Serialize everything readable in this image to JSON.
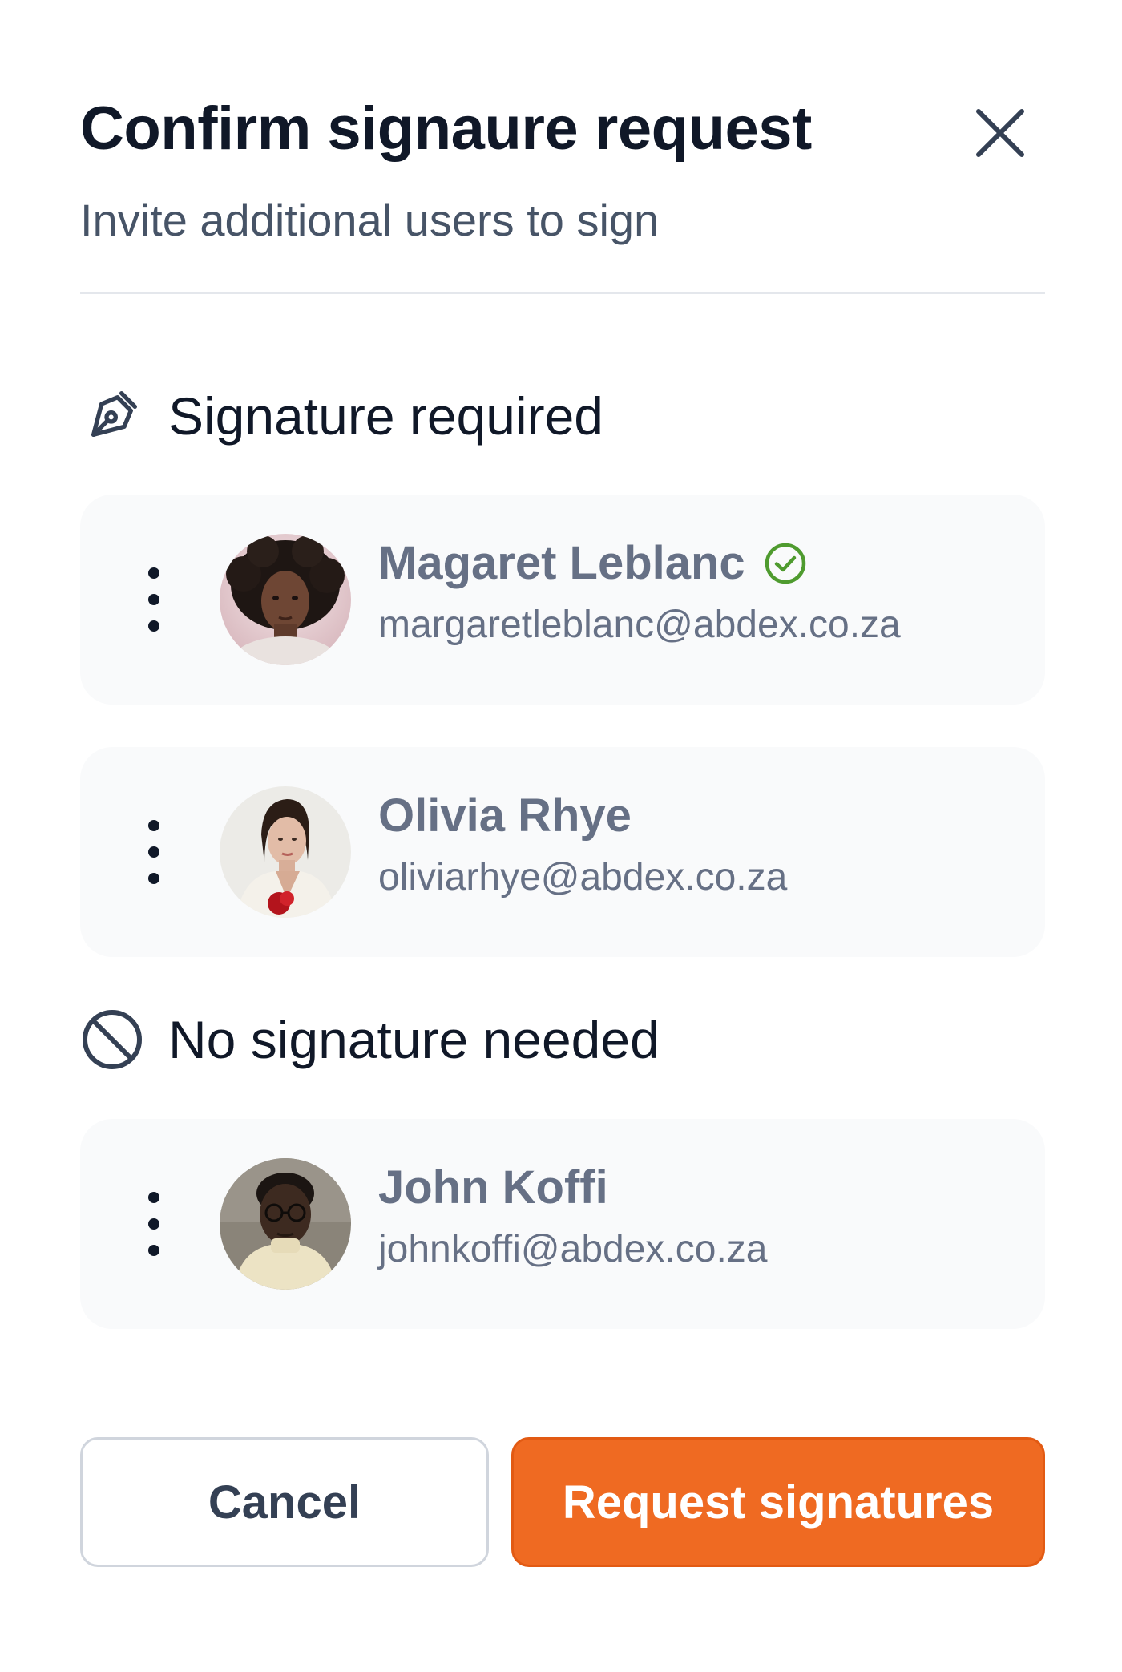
{
  "dialog": {
    "title": "Confirm signaure request",
    "subtitle": "Invite additional users to sign",
    "close_icon": "close-icon"
  },
  "sections": {
    "required": {
      "label": "Signature required",
      "icon": "pen-tool-icon"
    },
    "not_needed": {
      "label": "No signature needed",
      "icon": "slash-circle-icon"
    }
  },
  "signers": [
    {
      "name": "Magaret Leblanc",
      "email": "margaretleblanc@abdex.co.za",
      "verified": true
    },
    {
      "name": "Olivia Rhye",
      "email": "oliviarhye@abdex.co.za",
      "verified": false
    }
  ],
  "viewers": [
    {
      "name": "John Koffi",
      "email": "johnkoffi@abdex.co.za",
      "verified": false
    }
  ],
  "actions": {
    "cancel_label": "Cancel",
    "submit_label": "Request signatures"
  },
  "colors": {
    "primary": "#ef6a22",
    "verified": "#4f9b2f",
    "text_primary": "#101828",
    "text_muted": "#667085"
  }
}
